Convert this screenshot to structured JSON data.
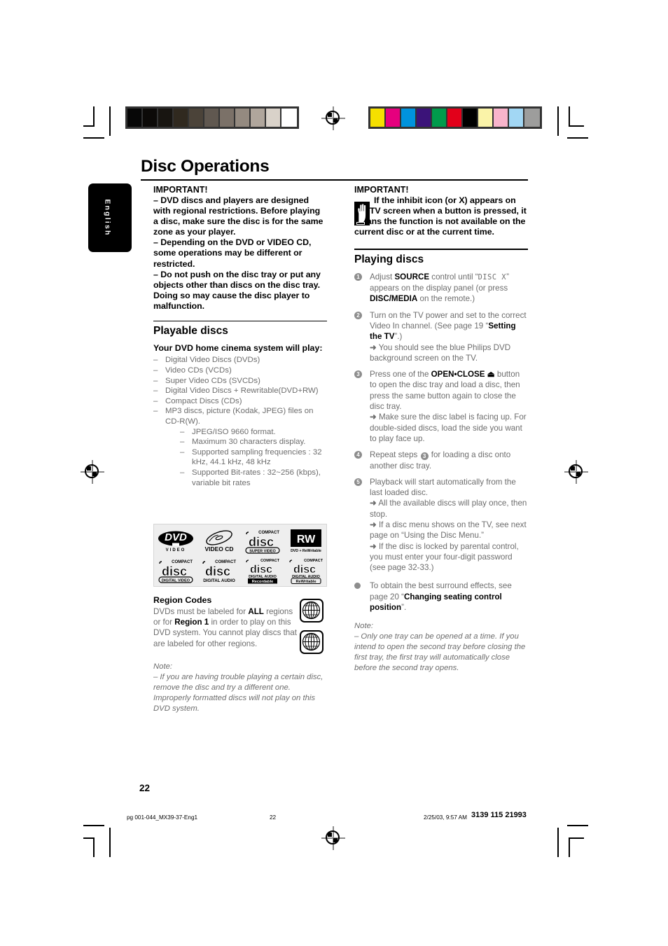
{
  "document": {
    "title": "Disc Operations",
    "language_tab": "English",
    "page_number": "22"
  },
  "colorbars": {
    "grayscale": [
      "#070707",
      "#0c0a08",
      "#181511",
      "#30291f",
      "#4b4339",
      "#605850",
      "#7b7168",
      "#948a80",
      "#b0a69c",
      "#d9d2c9",
      "#ffffff"
    ],
    "colors": [
      "#f5e000",
      "#e6007e",
      "#0093dd",
      "#3b1379",
      "#009b4c",
      "#e2001a",
      "#000000",
      "#faf3a8",
      "#f8b4cb",
      "#a2d7f4",
      "#9d9d9c"
    ]
  },
  "left_column": {
    "important": {
      "heading": "IMPORTANT!",
      "items": [
        "–  DVD discs and players are designed with regional restrictions. Before playing a disc, make sure the disc is for the same zone as your player.",
        "–  Depending on the DVD or VIDEO CD, some operations may be different or restricted.",
        "–  Do not push on the disc tray or put any objects other than discs on the disc tray.  Doing so may cause the disc player to malfunction."
      ]
    },
    "playable_discs": {
      "heading": "Playable discs",
      "subheading": "Your DVD home cinema system will play:",
      "items": [
        "Digital Video Discs (DVDs)",
        "Video CDs (VCDs)",
        "Super Video CDs (SVCDs)",
        "Digital Video Discs + Rewritable(DVD+RW)",
        "Compact Discs (CDs)",
        "MP3 discs, picture (Kodak, JPEG) files on CD-R(W)."
      ],
      "sub_items": [
        "JPEG/ISO 9660 format.",
        "Maximum 30 characters display.",
        "Supported sampling frequencies : 32 kHz, 44.1 kHz, 48 kHz",
        "Supported Bit-rates : 32~256 (kbps), variable bit rates"
      ]
    },
    "disc_logos": [
      {
        "name": "dvd-video-logo",
        "main": "DVD",
        "sub": "VIDEO"
      },
      {
        "name": "video-cd-logo",
        "main": "",
        "sub": "VIDEO CD"
      },
      {
        "name": "compact-disc-super-video-logo",
        "main": "disc",
        "top": "COMPACT",
        "sub": "SUPER VIDEO"
      },
      {
        "name": "dvd-rewritable-logo",
        "main": "RW",
        "sub": "DVD + ReWritable"
      },
      {
        "name": "compact-disc-digital-video-logo",
        "main": "disc",
        "top": "COMPACT",
        "sub": "DIGITAL VIDEO"
      },
      {
        "name": "compact-disc-digital-audio-logo",
        "main": "disc",
        "top": "COMPACT",
        "sub": "DIGITAL AUDIO"
      },
      {
        "name": "compact-disc-recordable-logo",
        "main": "disc",
        "top": "COMPACT",
        "sub": "DIGITAL AUDIO",
        "sub2": "Recordable"
      },
      {
        "name": "compact-disc-rewritable-logo",
        "main": "disc",
        "top": "COMPACT",
        "sub": "DIGITAL AUDIO",
        "sub2": "ReWritable"
      }
    ],
    "region_codes": {
      "heading": "Region Codes",
      "body_1": "DVDs must be labeled for ",
      "body_bold_1": "ALL",
      "body_2": " regions or for ",
      "body_bold_2": "Region 1",
      "body_3": " in order to play on this DVD system. You cannot play discs that are labeled for other regions."
    },
    "note": {
      "label": "Note:",
      "text": "–  If you are having trouble playing a certain disc, remove the disc and try a different one. Improperly formatted discs will not play on this DVD system."
    }
  },
  "right_column": {
    "important": {
      "heading": "IMPORTANT!",
      "text": "If the inhibit icon (or X) appears on the TV screen when a button is pressed, it means the function is not available on the current disc or at the current time."
    },
    "playing_discs": {
      "heading": "Playing discs",
      "steps": [
        {
          "num": "1",
          "pre": "Adjust ",
          "bold": "SOURCE",
          "mid": " control until “",
          "lcd": "DISC X",
          "mid2": "” appears on the display panel (or press ",
          "bold2": "DISC/MEDIA",
          "post": " on the remote.)"
        },
        {
          "num": "2",
          "pre": "Turn on the TV power and set to the correct Video In channel.  (See page 19 “",
          "bold": "Setting the TV",
          "post": "”.)",
          "arrows": [
            "You should see the blue Philips DVD background screen on the TV."
          ]
        },
        {
          "num": "3",
          "pre": "Press one of the ",
          "bold": "OPEN•CLOSE ⏏",
          "post": " button to open the disc tray and load a disc, then press the same button again to close the disc tray.",
          "arrows": [
            "Make sure the disc label is facing up.  For double-sided discs, load the side you want to play face up."
          ]
        },
        {
          "num": "4",
          "pre": "Repeat steps ",
          "ref": "3",
          "post": " for loading a disc onto another disc tray."
        },
        {
          "num": "5",
          "pre": "Playback will start automatically from the last loaded disc.",
          "arrows": [
            "All the available discs will play once, then stop.",
            "If a disc menu shows on the TV, see next page on “Using the Disc Menu.”",
            "If the disc is locked by parental control, you must enter your four-digit password (see page 32-33.)"
          ]
        }
      ],
      "bullet": {
        "pre": "To obtain the best surround effects, see page 20 “",
        "bold": "Changing seating control position",
        "post": "”."
      },
      "note": {
        "label": "Note:",
        "text": "–  Only one tray can be opened at a time.  If you intend to open the second tray before closing the first tray, the first tray will automatically close before the second tray opens."
      }
    }
  },
  "footer": {
    "file": "pg 001-044_MX39-37-Eng1",
    "page": "22",
    "date": "2/25/03, 9:57 AM",
    "code": "3139 115 21993"
  }
}
